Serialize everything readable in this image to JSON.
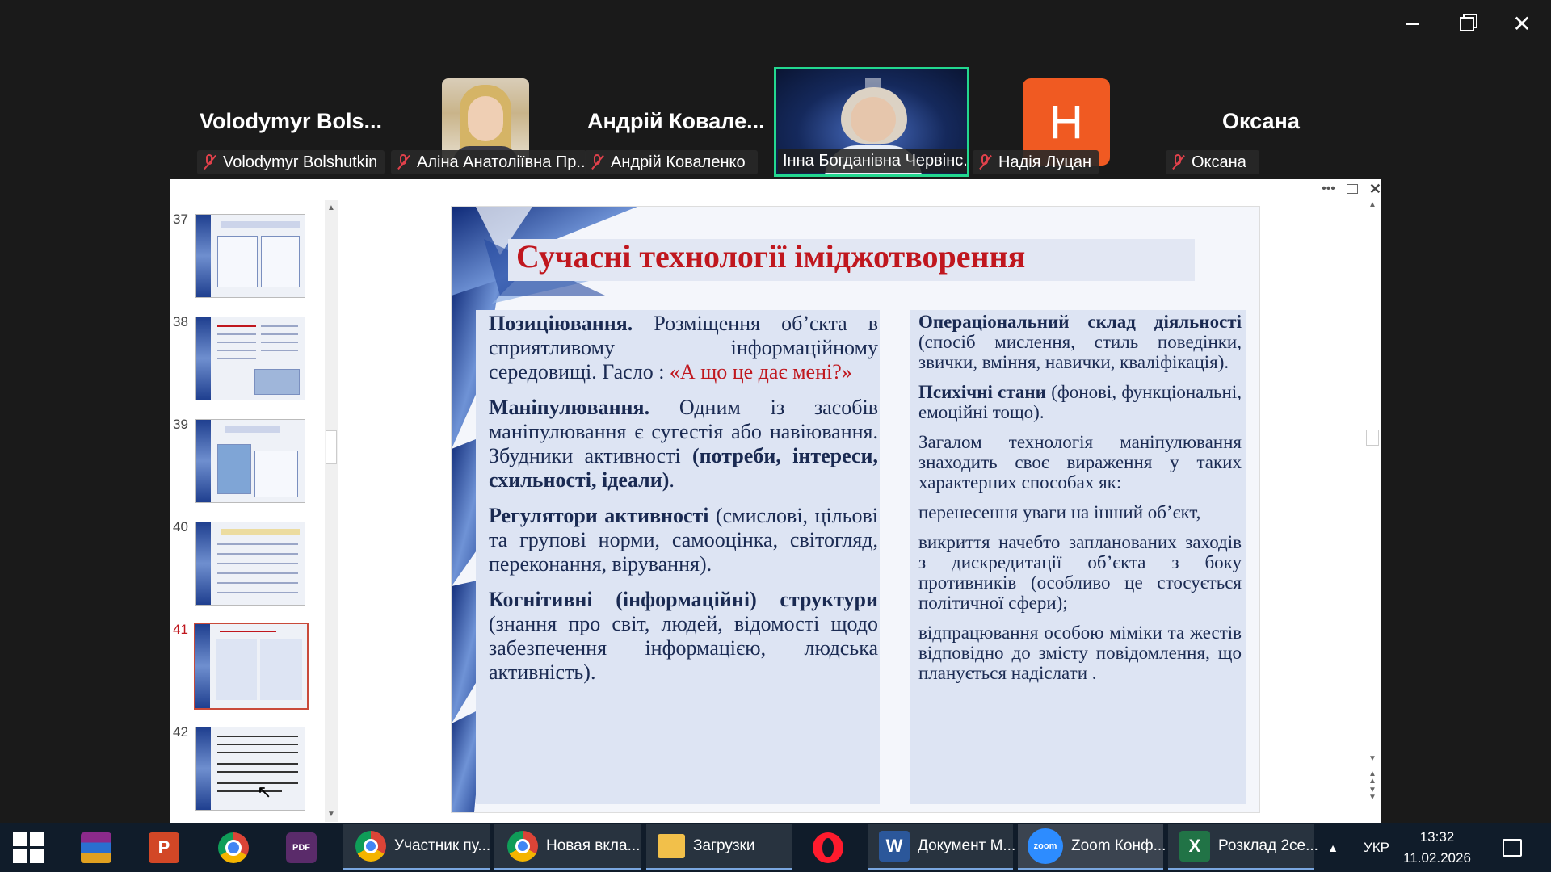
{
  "window": {
    "minimize_icon": "minimize-icon",
    "restore_icon": "restore-icon",
    "close_icon": "close-icon"
  },
  "participants": [
    {
      "big_name": "Volodymyr Bols...",
      "label": "Volodymyr Bolshutkin",
      "muted": true
    },
    {
      "big_name": "",
      "label": "Аліна Анатоліївна Пр...",
      "muted": true
    },
    {
      "big_name": "Андрій Ковале...",
      "label": "Андрій Коваленко",
      "muted": true
    },
    {
      "big_name": "",
      "label": "Інна Богданівна Червінс...",
      "muted": false,
      "active_speaker": true
    },
    {
      "big_name": "",
      "avatar_letter": "H",
      "label": "Надія Луцан",
      "muted": true
    },
    {
      "big_name": "Оксана",
      "label": "Оксана",
      "muted": true
    }
  ],
  "share_toolbar": {
    "more_icon": "more-icon",
    "popout_icon": "popout-icon",
    "close_icon": "close-icon"
  },
  "thumbnails": [
    {
      "num": "37",
      "selected": false
    },
    {
      "num": "38",
      "selected": false
    },
    {
      "num": "39",
      "selected": false
    },
    {
      "num": "40",
      "selected": false
    },
    {
      "num": "41",
      "selected": true
    },
    {
      "num": "42",
      "selected": false
    }
  ],
  "slide": {
    "title": "Сучасні технології іміджотворення",
    "left": [
      {
        "bold": "Позиціювання.",
        "text": " Розміщення об’єкта в сприятливому інформаційному середовищі. Гасло : ",
        "red": "«А що це дає мені?»"
      },
      {
        "bold": "Маніпулювання.",
        "text": " Одним із засобів маніпулювання є сугестія або навіювання. Збудники активності ",
        "bold2": "(потреби, інтереси, схильності, ідеали)",
        "tail": "."
      },
      {
        "bold": "Регулятори активності",
        "text": " (смислові, цільові та групові норми, самооцінка, світогляд, переконання, вірування)."
      },
      {
        "bold": "Когнітивні (інформаційні) структури",
        "text": " (знання про світ, людей, відомості щодо забезпечення інформацією, людська активність)."
      }
    ],
    "right": [
      {
        "bold": "Операціональний склад діяльності",
        "text": " (спосіб мислення, стиль поведінки, звички, вміння, навички, кваліфікація)."
      },
      {
        "bold": "Психічні стани",
        "text": " (фонові, функціональні, емоційні тощо)."
      },
      {
        "bold": "",
        "text": "Загалом технологія маніпулювання знаходить своє вираження у таких характерних способах як:"
      },
      {
        "bold": "",
        "text": " перенесення уваги на інший об’єкт,"
      },
      {
        "bold": "",
        "text": "викриття начебто запланованих заходів з дискредитації об’єкта з боку противників (особливо це стосується політичної сфери);"
      },
      {
        "bold": "",
        "text": " відпрацювання особою міміки та жестів відповідно до змісту повідомлення, що планується надіслати ."
      }
    ]
  },
  "taskbar": {
    "apps": [
      {
        "label": "",
        "icon": "windows-start-icon"
      },
      {
        "label": "",
        "icon": "winrar-icon"
      },
      {
        "label": "",
        "icon": "powerpoint-icon"
      },
      {
        "label": "",
        "icon": "chrome-icon"
      },
      {
        "label": "",
        "icon": "pdf-icon"
      },
      {
        "label": "Участник пу...",
        "icon": "chrome-profile-icon"
      },
      {
        "label": "Новая вкла...",
        "icon": "chrome-profile-icon"
      },
      {
        "label": "Загрузки",
        "icon": "folder-icon"
      },
      {
        "label": "",
        "icon": "opera-icon"
      },
      {
        "label": "Документ M...",
        "icon": "word-icon"
      },
      {
        "label": "Zoom Конф...",
        "icon": "zoom-icon"
      },
      {
        "label": "Розклад 2се...",
        "icon": "excel-icon"
      }
    ],
    "lang": "УКР",
    "time": "13:32",
    "date": "11.02.2026"
  }
}
